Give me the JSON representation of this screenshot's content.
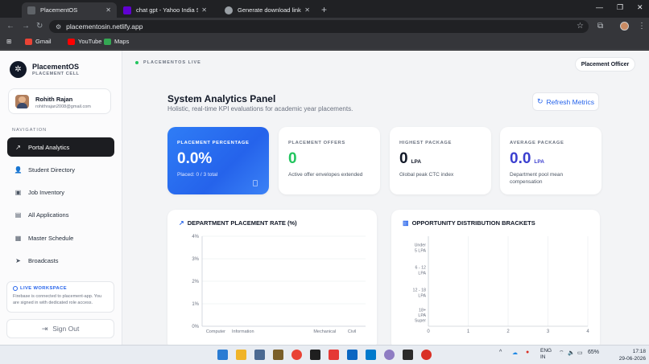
{
  "browser": {
    "tabs": [
      {
        "label": "PlacementOS",
        "active": true
      },
      {
        "label": "chat gpt - Yahoo India Search R",
        "active": false
      },
      {
        "label": "Generate download link",
        "active": false
      }
    ],
    "url": "placementosin.netlify.app",
    "bookmarks": [
      "Gmail",
      "YouTube",
      "Maps"
    ]
  },
  "sidebar": {
    "brand_name": "PlacementOS",
    "brand_sub": "PLACEMENT CELL",
    "user": {
      "name": "Rohith Rajan",
      "email": "rohithrajan2008@gmail.com"
    },
    "nav_heading": "NAVIGATION",
    "items": [
      {
        "label": "Portal Analytics",
        "icon": "trend-icon"
      },
      {
        "label": "Student Directory",
        "icon": "users-icon"
      },
      {
        "label": "Job Inventory",
        "icon": "briefcase-icon"
      },
      {
        "label": "All Applications",
        "icon": "file-icon"
      },
      {
        "label": "Master Schedule",
        "icon": "calendar-icon"
      },
      {
        "label": "Broadcasts",
        "icon": "send-icon"
      }
    ],
    "workspace": {
      "title": "LIVE WORKSPACE",
      "text": "Firebase is connected to placement-app. You are signed in with dedicated role access."
    },
    "signout_label": "Sign Out"
  },
  "header": {
    "live_label": "PLACEMENTOS LIVE",
    "role_label": "Placement Officer"
  },
  "main": {
    "title": "System Analytics Panel",
    "subtitle": "Holistic, real-time KPI evaluations for academic year placements.",
    "refresh_label": "Refresh Metrics",
    "stats": [
      {
        "label": "PLACEMENT PERCENTAGE",
        "value": "0.0%",
        "unit": "",
        "sub": "Placed: 0 / 3 total",
        "color": "#ffffff"
      },
      {
        "label": "PLACEMENT OFFERS",
        "value": "0",
        "unit": "",
        "sub": "Active offer envelopes extended",
        "color": "#22c55e"
      },
      {
        "label": "HIGHEST PACKAGE",
        "value": "0",
        "unit": "LPA",
        "sub": "Global peak CTC index",
        "color": "#111827"
      },
      {
        "label": "AVERAGE PACKAGE",
        "value": "0.0",
        "unit": "LPA",
        "sub": "Department pool mean compensation",
        "color": "#3b3fcf"
      }
    ]
  },
  "chart_data": [
    {
      "type": "bar",
      "title": "DEPARTMENT PLACEMENT RATE (%)",
      "categories": [
        "Computer",
        "Information",
        "",
        "",
        "Mechanical",
        "Civil"
      ],
      "values": [
        0,
        0,
        0,
        0,
        0,
        0
      ],
      "y_ticks": [
        "4%",
        "3%",
        "2%",
        "1%",
        "0%"
      ],
      "ylim": [
        0,
        4
      ],
      "grid": true
    },
    {
      "type": "bar",
      "orientation": "horizontal",
      "title": "OPPORTUNITY DISTRIBUTION BRACKETS",
      "categories": [
        [
          "Under",
          "5 LPA"
        ],
        [
          "6 - 12",
          "LPA"
        ],
        [
          "12 - 18",
          "LPA"
        ],
        [
          "18+",
          "LPA",
          "Super"
        ]
      ],
      "values": [
        0,
        0,
        0,
        0
      ],
      "x_ticks": [
        "0",
        "1",
        "2",
        "3",
        "4"
      ],
      "xlim": [
        0,
        4
      ],
      "grid": true
    }
  ],
  "taskbar": {
    "lang": [
      "ENG",
      "IN"
    ],
    "battery": "65%",
    "time": "17:18",
    "date": "29-06-2026"
  }
}
